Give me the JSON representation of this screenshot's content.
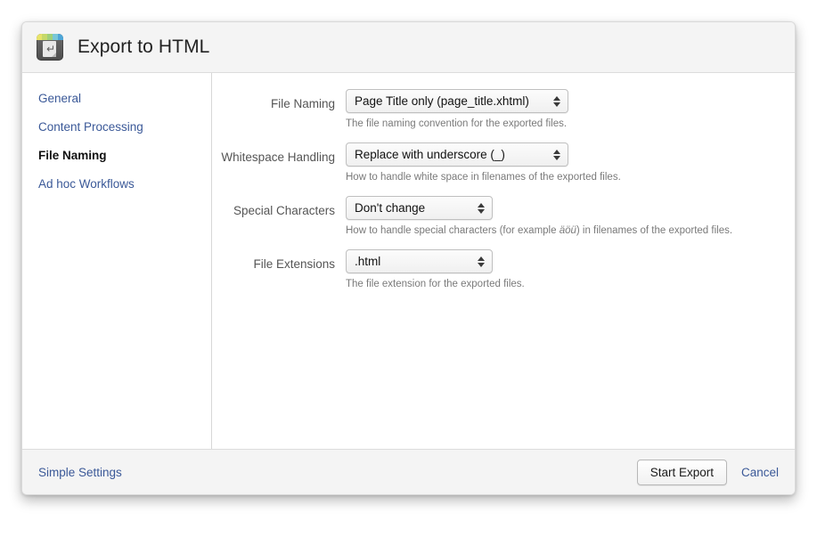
{
  "window": {
    "title": "Export to HTML",
    "icon": "export-html-app-icon",
    "icon_stripe_colors": [
      "#e8e36a",
      "#c6d96a",
      "#9fd07a",
      "#79c7d8",
      "#4ea6d8"
    ]
  },
  "sidebar": {
    "items": [
      {
        "label": "General",
        "active": false
      },
      {
        "label": "Content Processing",
        "active": false
      },
      {
        "label": "File Naming",
        "active": true
      },
      {
        "label": "Ad hoc Workflows",
        "active": false
      }
    ]
  },
  "form": {
    "rows": [
      {
        "label": "File Naming",
        "value": "Page Title only (page_title.xhtml)",
        "help_before": "The file naming convention for the exported files.",
        "help_italic": "",
        "help_after": "",
        "width": "wide"
      },
      {
        "label": "Whitespace Handling",
        "value": "Replace with underscore (_)",
        "help_before": "How to handle white space in filenames of the exported files.",
        "help_italic": "",
        "help_after": "",
        "width": "wide"
      },
      {
        "label": "Special Characters",
        "value": "Don't change",
        "help_before": "How to handle special characters (for example ",
        "help_italic": "äöü",
        "help_after": ") in filenames of the exported files.",
        "width": "narrow"
      },
      {
        "label": "File Extensions",
        "value": ".html",
        "help_before": "The file extension for the exported files.",
        "help_italic": "",
        "help_after": "",
        "width": "narrow"
      }
    ]
  },
  "footer": {
    "simple_settings_label": "Simple Settings",
    "start_export_label": "Start Export",
    "cancel_label": "Cancel"
  },
  "colors": {
    "link": "#3b5998",
    "header_bg": "#f4f4f4",
    "label": "#555555",
    "help": "#7a7a7a"
  }
}
